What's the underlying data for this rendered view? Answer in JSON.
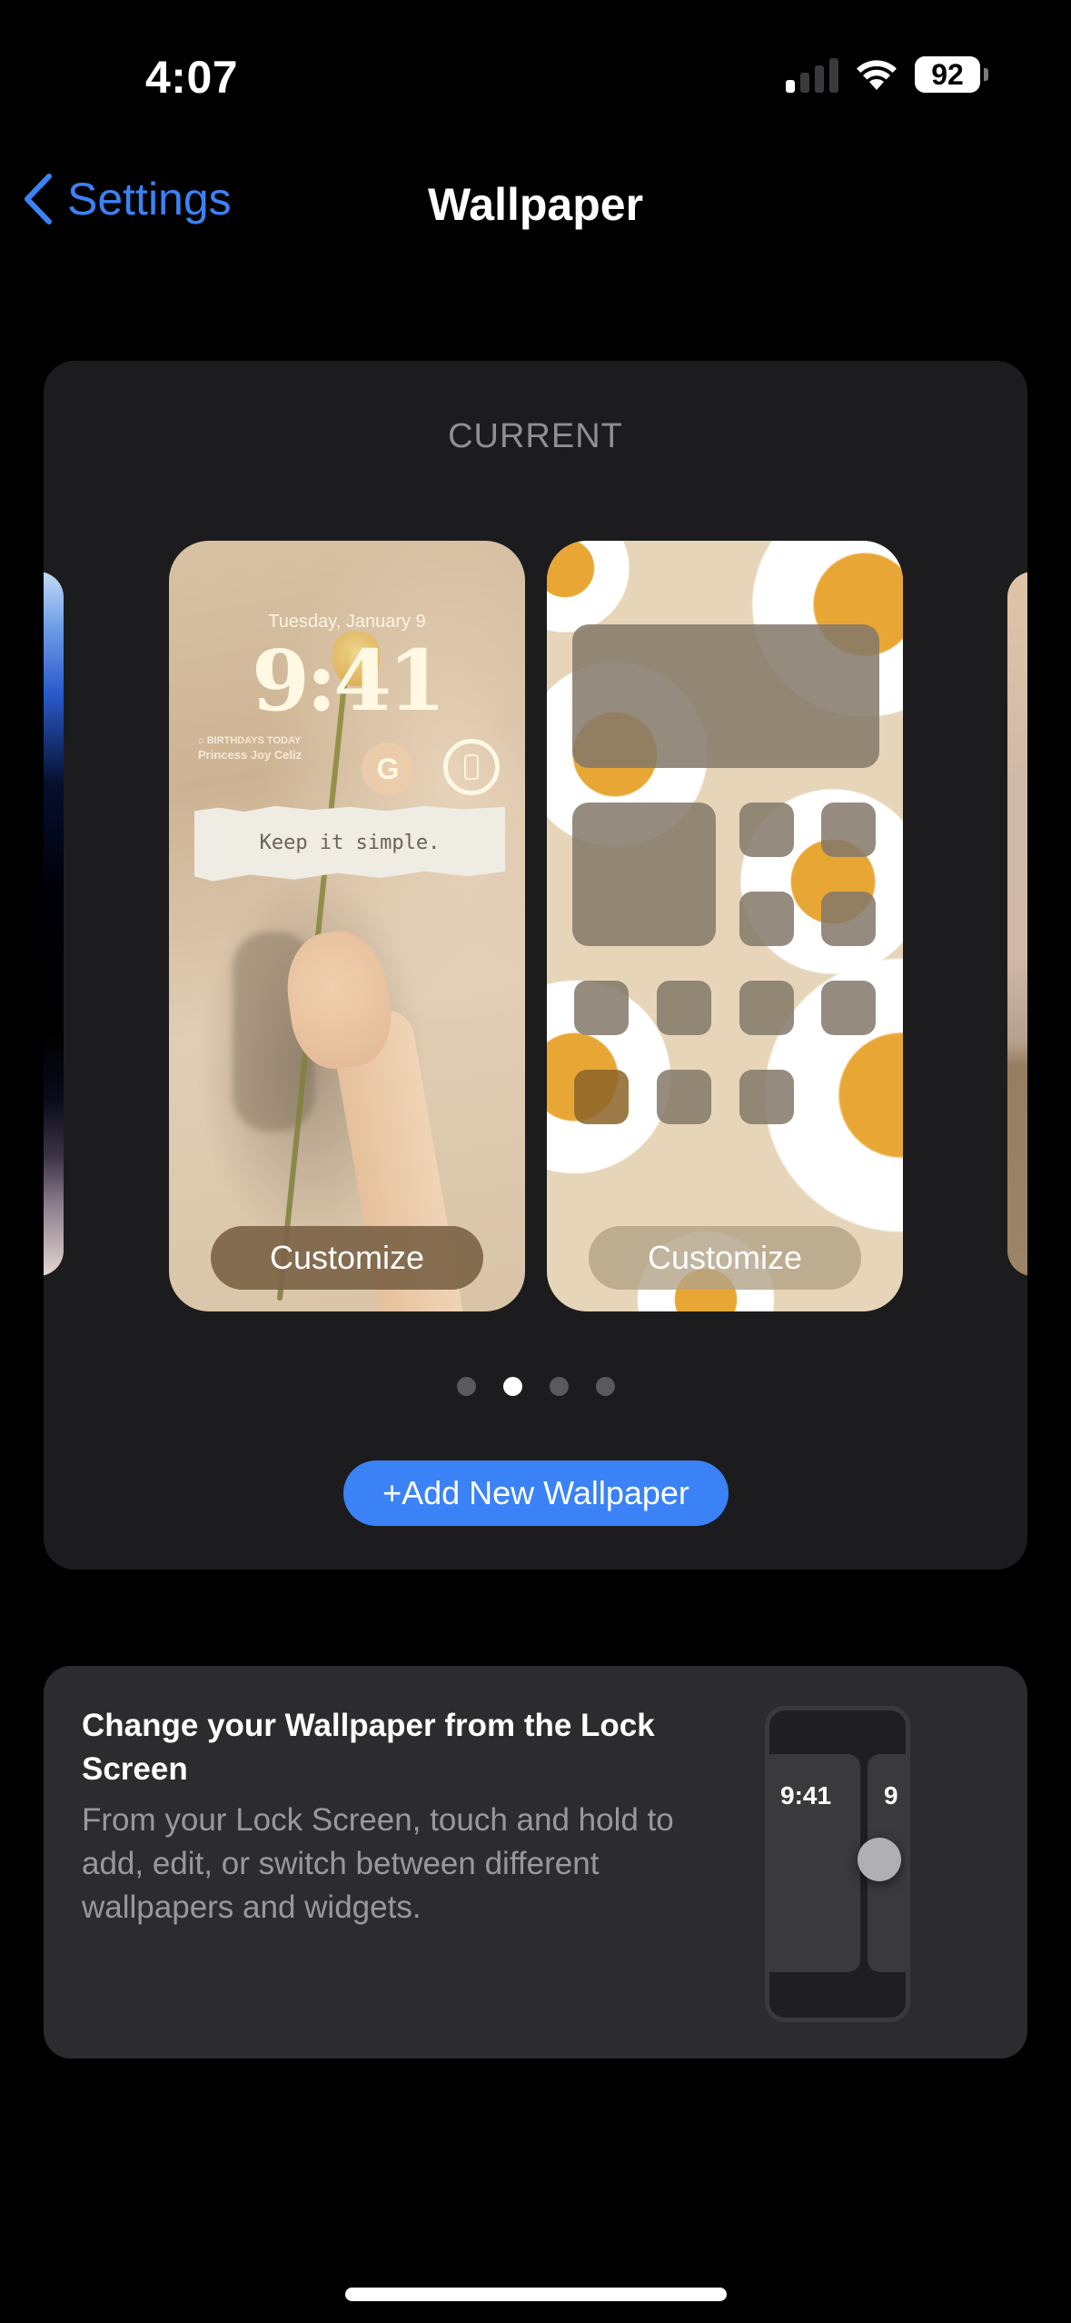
{
  "status_bar": {
    "time": "4:07",
    "signal_bars_active": 1,
    "signal_bars_total": 4,
    "wifi_icon": "wifi-icon",
    "battery_percent": "92"
  },
  "nav": {
    "back_label": "Settings",
    "back_icon": "chevron-left-icon",
    "title": "Wallpaper"
  },
  "current_section": {
    "label": "CURRENT",
    "lock_screen_preview": {
      "date": "Tuesday, January 9",
      "time": "9:41",
      "birthday_widget_title": "BIRTHDAYS TODAY",
      "birthday_widget_name": "Princess Joy Celiz",
      "google_widget_letter": "G",
      "quote": "Keep it simple.",
      "customize_label": "Customize"
    },
    "home_screen_preview": {
      "customize_label": "Customize"
    },
    "page_dots": {
      "count": 4,
      "active_index": 1
    },
    "add_button_label": "+Add New Wallpaper",
    "accent_color": "#3b82f6"
  },
  "tip_card": {
    "title": "Change your Wallpaper from the Lock Screen",
    "body": "From your Lock Screen, touch and hold to add, edit, or switch between different wallpapers and widgets.",
    "illustration_time_1": "9:41",
    "illustration_time_2": "9"
  }
}
